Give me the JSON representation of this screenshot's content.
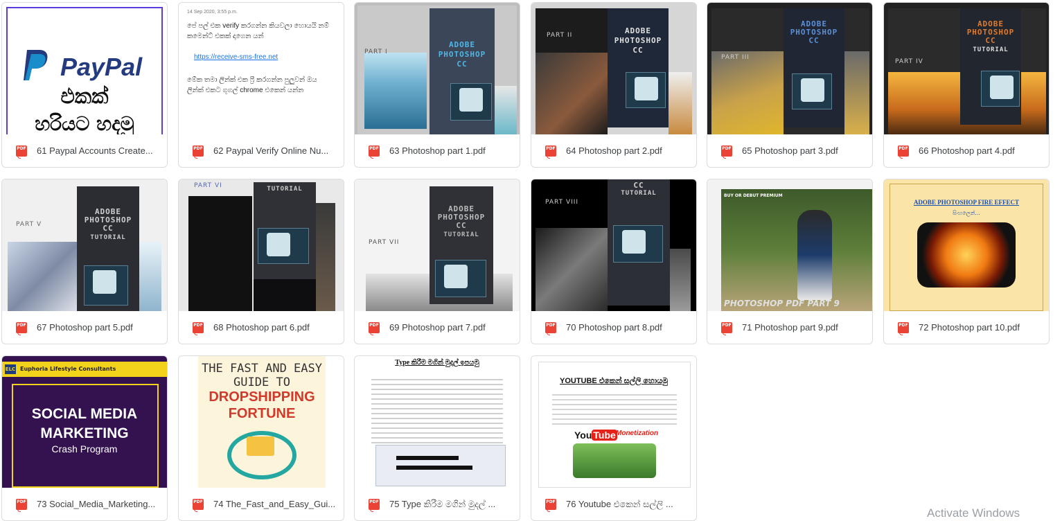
{
  "files": [
    {
      "name": "61 Paypal Accounts Create...",
      "thumb": "paypal"
    },
    {
      "name": "62 Paypal Verify Online Nu...",
      "thumb": "text-note"
    },
    {
      "name": "63 Photoshop part 1.pdf",
      "thumb": "ps1"
    },
    {
      "name": "64 Photoshop part 2.pdf",
      "thumb": "ps2"
    },
    {
      "name": "65 Photoshop part 3.pdf",
      "thumb": "ps3"
    },
    {
      "name": "66 Photoshop part 4.pdf",
      "thumb": "ps4"
    },
    {
      "name": "67 Photoshop part 5.pdf",
      "thumb": "ps5"
    },
    {
      "name": "68 Photoshop part 6.pdf",
      "thumb": "ps6"
    },
    {
      "name": "69 Photoshop part 7.pdf",
      "thumb": "ps7"
    },
    {
      "name": "70 Photoshop part 8.pdf",
      "thumb": "ps8"
    },
    {
      "name": "71 Photoshop part 9.pdf",
      "thumb": "ps9"
    },
    {
      "name": "72 Photoshop part 10.pdf",
      "thumb": "ps10"
    },
    {
      "name": "73 Social_Media_Marketing...",
      "thumb": "social"
    },
    {
      "name": "74 The_Fast_and_Easy_Gui...",
      "thumb": "dropship"
    },
    {
      "name": "75 Type කිරීම මගින් මුදල් ...",
      "thumb": "typedoc"
    },
    {
      "name": "76 Youtube එකෙන් සල්ලි ...",
      "thumb": "youtube"
    }
  ],
  "pdf_icon_label": "PDF",
  "thumbs": {
    "paypal": {
      "brand": "PayPal",
      "line1": "එකක්",
      "line2": "හරියට හදමු"
    },
    "note": {
      "timestamp": "14 Sep 2020, 3:55 p.m.",
      "p1": "පේ පල් එක verify කරගන්න කියවලා හොයයි නම් කමෙන්ට් එකක් දාගෙන යන්",
      "link": "https://receive-sms-free.net",
      "p2": "මේක තමා ලින්ක් එක ෆ්‍රී කරගන්න පුලුවන් ඔය ලින්ක් එකට ගූගල් chrome එකෙන් යන්න"
    },
    "ps": {
      "adobe": "ADOBE",
      "photoshop": "PHOTOSHOP",
      "cc": "CC",
      "tutorial": "TUTORIAL"
    },
    "ps_parts": {
      "p1": "PART I",
      "p2": "PART II",
      "p3": "PART III",
      "p4": "PART IV",
      "p5": "PART V",
      "p6": "PART VI",
      "p7": "PART VII",
      "p8": "PART VIII"
    },
    "ps9": {
      "label": "BUY OR DEBUT PREMIUM",
      "caption": "PHOTOSHOP PDF PART 9"
    },
    "ps10": {
      "title": "ADOBE PHOTOSHOP FIRE EFFECT",
      "sub": "සිංහලෙන්..."
    },
    "social": {
      "company_abbr": "ELC",
      "company": "Euphoria Lifestyle Consultants",
      "line1": "SOCIAL MEDIA",
      "line2": "MARKETING",
      "line3": "Crash Program"
    },
    "dropship": {
      "l1": "THE FAST AND EASY",
      "l2": "GUIDE TO",
      "l3": "DROPSHIPPING",
      "l4": "FORTUNE"
    },
    "typedoc": {
      "title": "Type කිරීම මගින් මුදල් ඉපයමු"
    },
    "youtube": {
      "title": "YOUTUBE එකෙන් සල්ලි හොයමු",
      "you": "You",
      "tube": "Tube",
      "mon": "Monetization"
    }
  },
  "watermark": "Activate Windows",
  "colors": {
    "pdf_red": "#ea4335",
    "paypal_blue": "#253b80",
    "paypal_light": "#179bd7"
  }
}
